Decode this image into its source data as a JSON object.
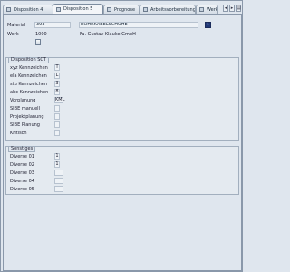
{
  "tabs": [
    {
      "label": "Disposition 4"
    },
    {
      "label": "Disposition 5"
    },
    {
      "label": "Prognose"
    },
    {
      "label": "Arbeitsvorbereitung"
    },
    {
      "label": "Werk"
    }
  ],
  "header": {
    "material_label": "Material",
    "material_value": "393",
    "material_desc": "ROHRKABELSCHUHE",
    "info_glyph": "i",
    "plant_label": "Werk",
    "plant_value": "1000",
    "plant_desc": "Fa. Gustav Klauke GmbH"
  },
  "mrp": {
    "title": "Disposition SCT",
    "rows": [
      {
        "label": "xyz Kennzeichen",
        "value": "T"
      },
      {
        "label": "ela Kennzeichen",
        "value": "L"
      },
      {
        "label": "stu Kennzeichen",
        "value": "3"
      },
      {
        "label": "abc Kennzeichen",
        "value": "8"
      },
      {
        "label": "Vorplanung",
        "value": "KML"
      },
      {
        "label": "SIBE manuell",
        "value": ""
      },
      {
        "label": "Projektplanung",
        "value": ""
      },
      {
        "label": "SIBE Planung",
        "value": ""
      },
      {
        "label": "Kritisch",
        "value": ""
      }
    ]
  },
  "misc": {
    "title": "Sonstiges",
    "rows": [
      {
        "label": "Diverse 01",
        "value": "1"
      },
      {
        "label": "Diverse 02",
        "value": "1"
      },
      {
        "label": "Diverse 03",
        "value": ""
      },
      {
        "label": "Diverse 04",
        "value": ""
      },
      {
        "label": "Diverse 05",
        "value": ""
      }
    ]
  },
  "nav": {
    "left": "◂",
    "right": "▸",
    "menu": "▤"
  },
  "colors": {
    "background": "#dfe6ee",
    "active_tab": "#f3f5f8",
    "info_button": "#203877"
  }
}
